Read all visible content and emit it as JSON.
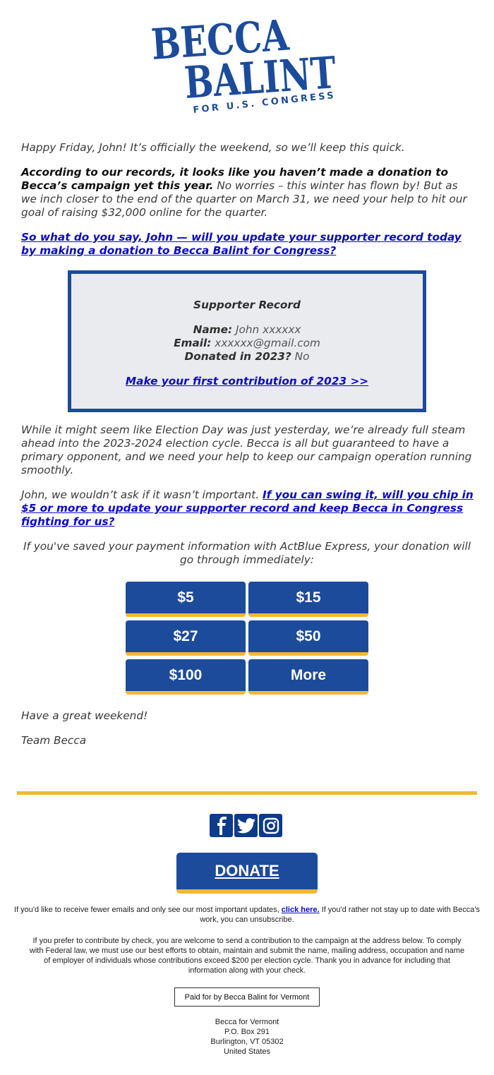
{
  "header": {
    "logo": {
      "line1": "BECCA",
      "line2": "BALINT",
      "tagline": "FOR U.S. CONGRESS"
    }
  },
  "body": {
    "greeting": "Happy Friday, John! It’s officially the weekend, so we’ll keep this quick.",
    "records_bold": "According to our records, it looks like you haven’t made a donation to Becca’s campaign yet this year.",
    "records_rest": " No worries – this winter has flown by! But as we inch closer to the end of the quarter on March 31, we need your help to hit our goal of raising $32,000 online for the quarter.",
    "cta_link": "So what do you say, John — will you update your supporter record today by making a donation to Becca Balint for Congress?"
  },
  "record": {
    "title": "Supporter Record",
    "name_label": "Name:",
    "name_value": " John xxxxxx",
    "email_label": "Email:",
    "email_value": " xxxxxx@gmail.com",
    "donated_label": "Donated in 2023?",
    "donated_value": " No",
    "link": "Make your first contribution of 2023 >>"
  },
  "body2": {
    "election_paragraph": "While it might seem like Election Day was just yesterday, we’re already full steam ahead into the 2023-2024 election cycle. Becca is all but guaranteed to have a primary opponent, and we need your help to keep our campaign operation running smoothly.",
    "ask_intro": "John, we wouldn’t ask if it wasn’t important. ",
    "ask_link": "If you can swing it, will you chip in $5 or more to update your supporter record and keep Becca in Congress fighting for us?",
    "express_note": "If you've saved your payment information with ActBlue Express, your donation will go through immediately:"
  },
  "amounts": [
    "$5",
    "$15",
    "$27",
    "$50",
    "$100",
    "More"
  ],
  "signoff": {
    "line1": "Have a great weekend!",
    "line2": "Team Becca"
  },
  "footer": {
    "social": [
      "facebook-icon",
      "twitter-icon",
      "instagram-icon"
    ],
    "donate_label": "DONATE",
    "fewer_emails_pre": "If you'd like to receive fewer emails and only see our most important updates, ",
    "fewer_emails_link": "click here.",
    "fewer_emails_post": " If you'd rather not stay up to date with Becca's work, you can unsubscribe.",
    "check_note": "If you prefer to contribute by check, you are welcome to send a contribution to the campaign at the address below. To comply with Federal law, we must use our best efforts to obtain, maintain and submit the name, mailing address, occupation and name of employer of individuals whose contributions exceed $200 per election cycle. Thank you in advance for including that information along with your check.",
    "paid_for": "Paid for by Becca Balint for Vermont",
    "address": [
      "Becca for Vermont",
      "P.O. Box 291",
      "Burlington, VT 05302",
      "United States"
    ]
  },
  "colors": {
    "brand_blue": "#1c4b9c",
    "accent_gold": "#f2b830",
    "link_blue": "#0a0acb",
    "record_bg": "#eaebef"
  }
}
